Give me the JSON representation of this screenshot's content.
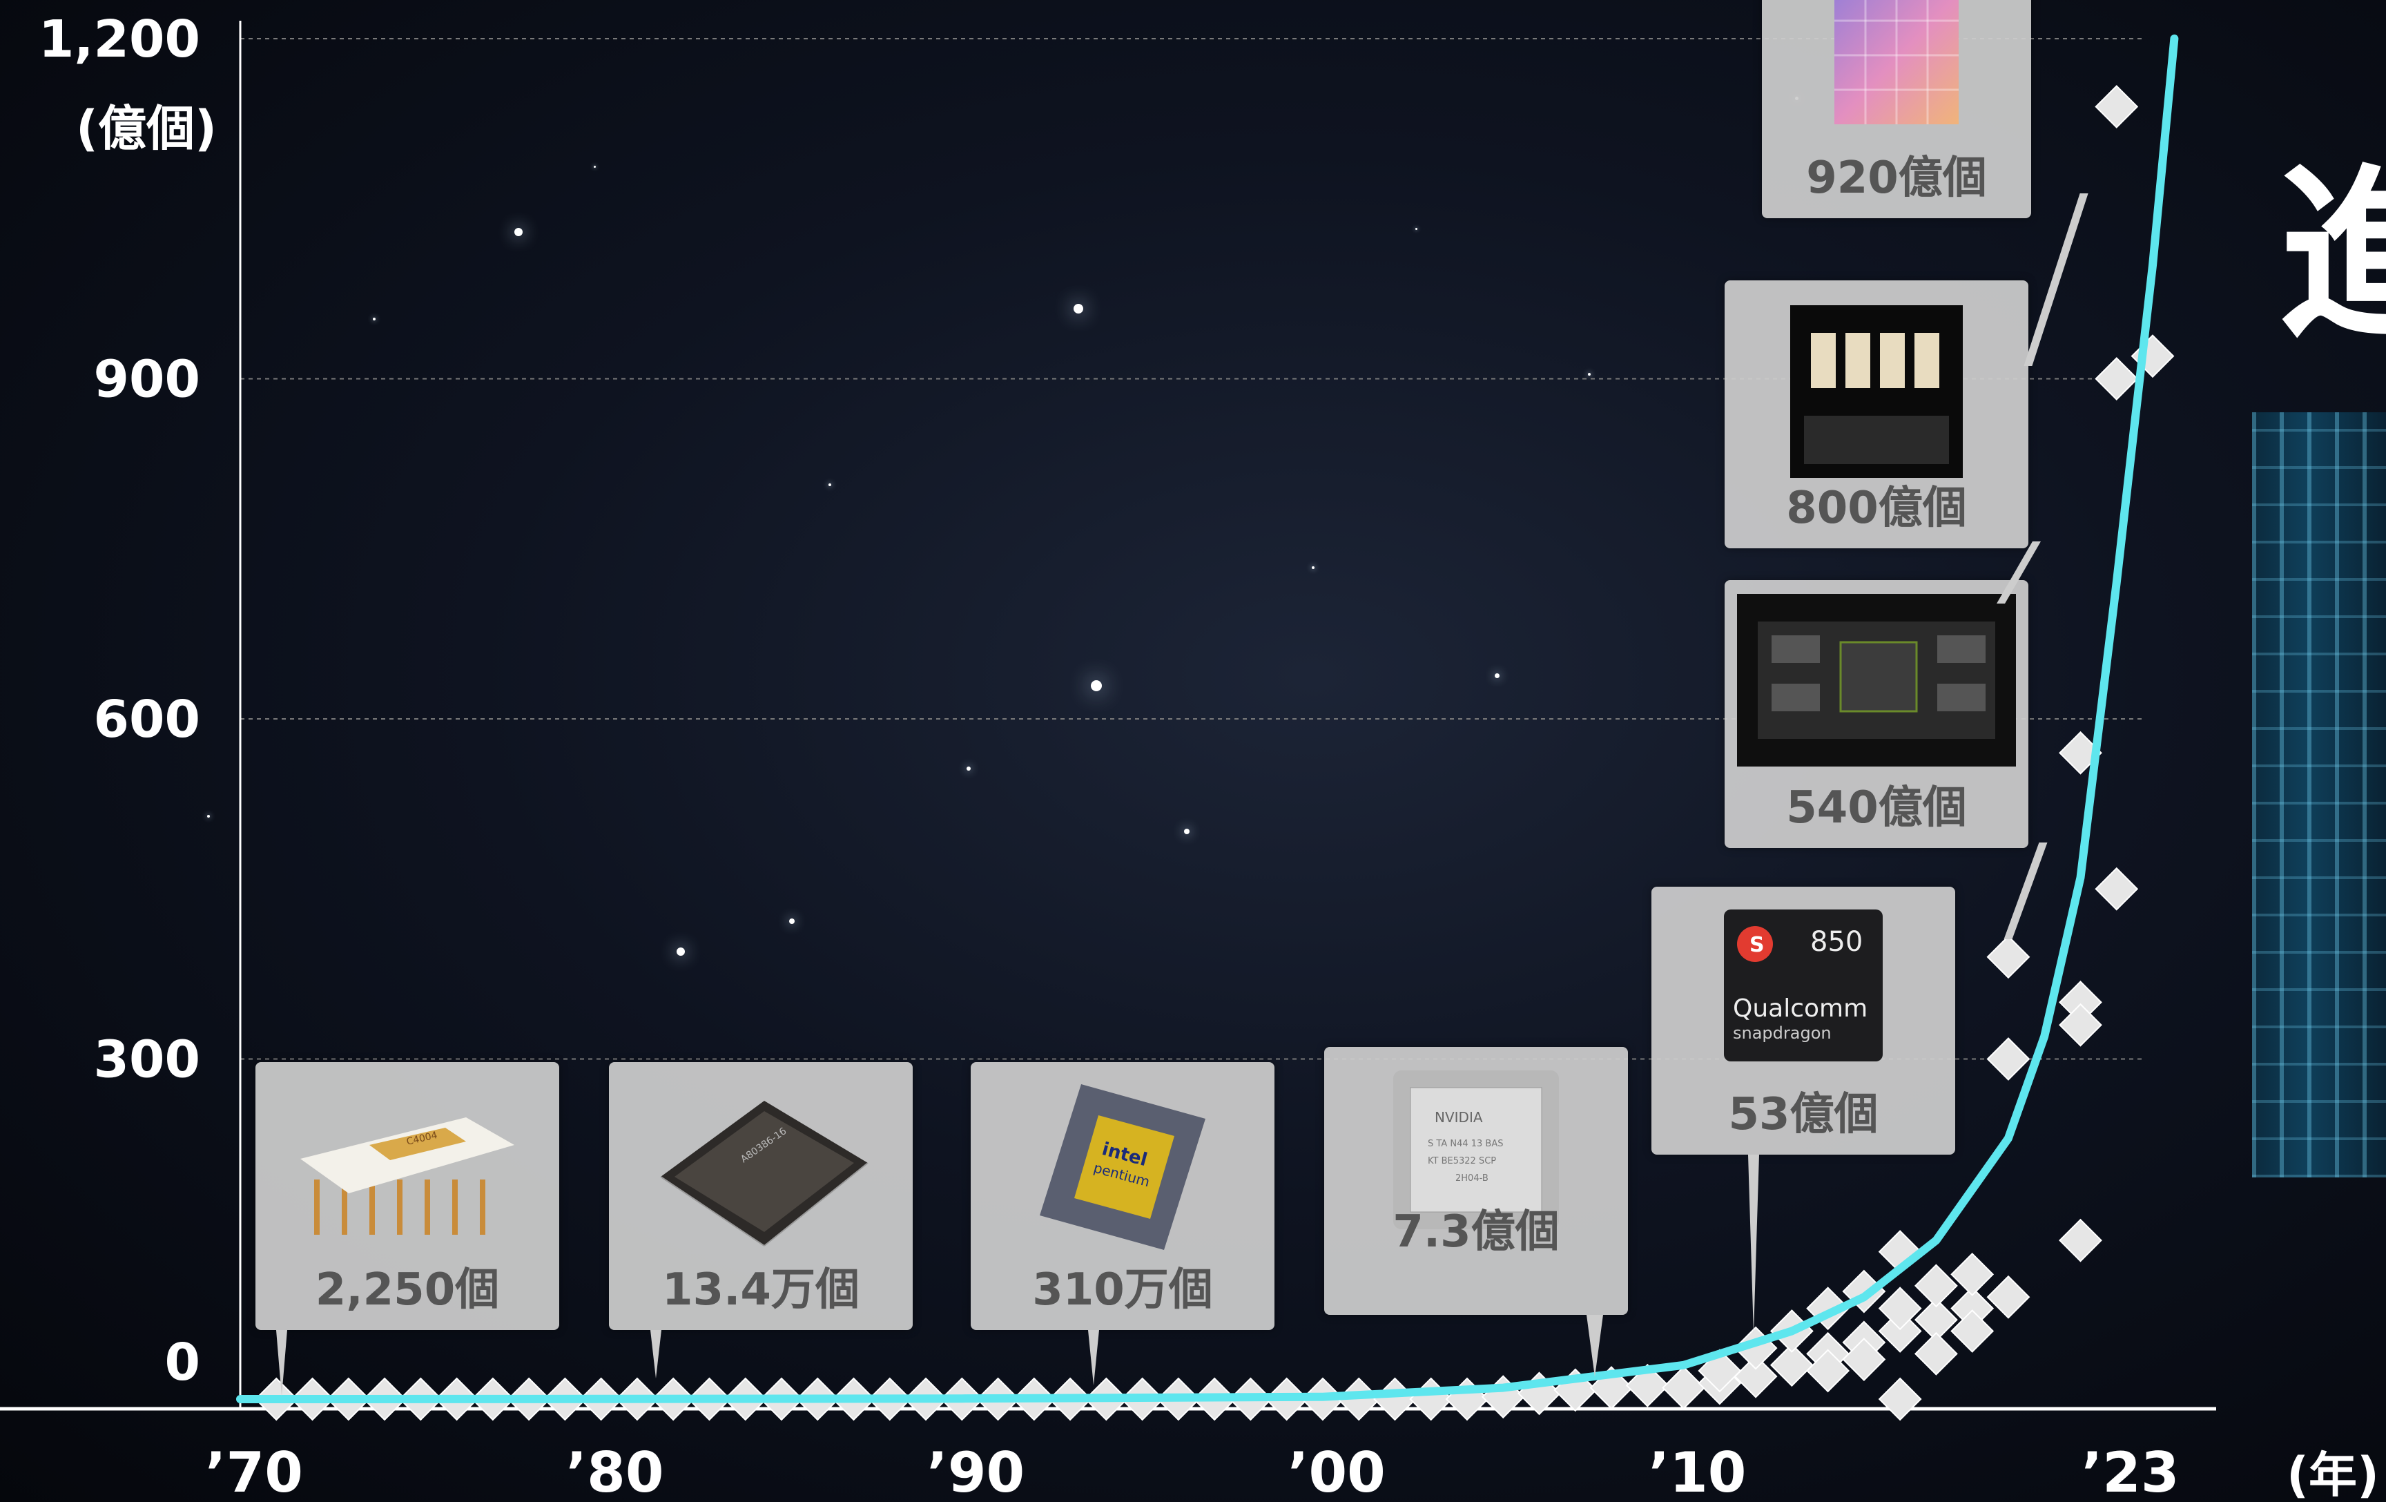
{
  "chart_data": {
    "type": "scatter",
    "title": "",
    "xlabel": "(年)",
    "ylabel": "(億個)",
    "x_ticks": [
      {
        "value": 1970,
        "label": "’70"
      },
      {
        "value": 1980,
        "label": "’80"
      },
      {
        "value": 1990,
        "label": "’90"
      },
      {
        "value": 2000,
        "label": "’00"
      },
      {
        "value": 2010,
        "label": "’10"
      },
      {
        "value": 2022,
        "label": "’23"
      }
    ],
    "y_ticks": [
      {
        "value": 0,
        "label": "0"
      },
      {
        "value": 300,
        "label": "300"
      },
      {
        "value": 600,
        "label": "600"
      },
      {
        "value": 900,
        "label": "900"
      },
      {
        "value": 1200,
        "label": "1,200"
      }
    ],
    "xlim": [
      1970,
      2023
    ],
    "ylim": [
      0,
      1200
    ],
    "grid": true,
    "series": [
      {
        "name": "",
        "points": [
          [
            1971,
            0
          ],
          [
            1972,
            0
          ],
          [
            1973,
            0
          ],
          [
            1974,
            0
          ],
          [
            1975,
            0
          ],
          [
            1976,
            0
          ],
          [
            1977,
            0
          ],
          [
            1978,
            0
          ],
          [
            1979,
            0
          ],
          [
            1980,
            0
          ],
          [
            1981,
            0
          ],
          [
            1982,
            0
          ],
          [
            1983,
            0
          ],
          [
            1984,
            0
          ],
          [
            1985,
            0
          ],
          [
            1986,
            0
          ],
          [
            1987,
            0
          ],
          [
            1988,
            0
          ],
          [
            1989,
            0
          ],
          [
            1990,
            0
          ],
          [
            1991,
            0
          ],
          [
            1992,
            0
          ],
          [
            1993,
            0
          ],
          [
            1994,
            0
          ],
          [
            1995,
            0
          ],
          [
            1996,
            0
          ],
          [
            1997,
            0
          ],
          [
            1998,
            0
          ],
          [
            1999,
            0
          ],
          [
            2000,
            0
          ],
          [
            2001,
            0
          ],
          [
            2002,
            0
          ],
          [
            2003,
            0
          ],
          [
            2004,
            0
          ],
          [
            2005,
            2
          ],
          [
            2006,
            5
          ],
          [
            2007,
            8
          ],
          [
            2008,
            10
          ],
          [
            2009,
            12
          ],
          [
            2010,
            10
          ],
          [
            2011,
            14
          ],
          [
            2011,
            25
          ],
          [
            2012,
            20
          ],
          [
            2012,
            45
          ],
          [
            2013,
            30
          ],
          [
            2013,
            60
          ],
          [
            2014,
            40
          ],
          [
            2014,
            80
          ],
          [
            2014,
            25
          ],
          [
            2015,
            50
          ],
          [
            2015,
            95
          ],
          [
            2015,
            35
          ],
          [
            2016,
            60
          ],
          [
            2016,
            130
          ],
          [
            2016,
            80
          ],
          [
            2016,
            0
          ],
          [
            2017,
            70
          ],
          [
            2017,
            100
          ],
          [
            2017,
            40
          ],
          [
            2018,
            80
          ],
          [
            2018,
            110
          ],
          [
            2018,
            60
          ],
          [
            2019,
            90
          ],
          [
            2019,
            300
          ],
          [
            2019,
            390
          ],
          [
            2021,
            140
          ],
          [
            2021,
            350
          ],
          [
            2021,
            330
          ],
          [
            2021,
            570
          ],
          [
            2022,
            450
          ],
          [
            2022,
            900
          ],
          [
            2022,
            1140
          ],
          [
            2023,
            920
          ]
        ]
      },
      {
        "name": "",
        "type": "line",
        "points": [
          [
            1970,
            0
          ],
          [
            1980,
            0.1
          ],
          [
            1990,
            0.5
          ],
          [
            2000,
            2
          ],
          [
            2005,
            10
          ],
          [
            2010,
            30
          ],
          [
            2013,
            60
          ],
          [
            2015,
            90
          ],
          [
            2017,
            140
          ],
          [
            2019,
            230
          ],
          [
            2020,
            320
          ],
          [
            2021,
            460
          ],
          [
            2022,
            720
          ],
          [
            2023,
            1000
          ],
          [
            2023.6,
            1200
          ]
        ]
      }
    ],
    "annotations": [
      {
        "label": "2,250個",
        "x": 1971
      },
      {
        "label": "13.4万個",
        "x": 1981
      },
      {
        "label": "310万個",
        "x": 1993
      },
      {
        "label": "7.3億個",
        "x": 2008
      },
      {
        "label": "53億個",
        "x": 2012
      },
      {
        "label": "540億個",
        "x": 2021
      },
      {
        "label": "800億個",
        "x": 2022
      },
      {
        "label": "920億個",
        "x": 2023
      }
    ]
  },
  "colors": {
    "trend_line": "#5ee6ee",
    "marker": "#e6e6e6",
    "grid": "#7a7a7a",
    "axis": "#ffffff",
    "callout_bg": "#cdcdcd",
    "callout_text": "#555555"
  },
  "callouts": [
    {
      "label": "2,250個",
      "chip_icon": "intel-4004-chip-icon"
    },
    {
      "label": "13.4万個",
      "chip_icon": "intel-386-chip-icon"
    },
    {
      "label": "310万個",
      "chip_icon": "intel-pentium-chip-icon"
    },
    {
      "label": "7.3億個",
      "chip_icon": "nvidia-gpu-chip-icon"
    },
    {
      "label": "53億個",
      "chip_icon": "snapdragon-850-chip-icon",
      "chip_text": "850",
      "chip_brand": "Qualcomm",
      "chip_sub": "snapdragon"
    },
    {
      "label": "540億個",
      "chip_icon": "nvidia-a100-module-icon"
    },
    {
      "label": "800億個",
      "chip_icon": "nvidia-h100-module-icon"
    },
    {
      "label": "920億個",
      "chip_icon": "colorful-die-icon"
    }
  ],
  "heading_partial": "進"
}
